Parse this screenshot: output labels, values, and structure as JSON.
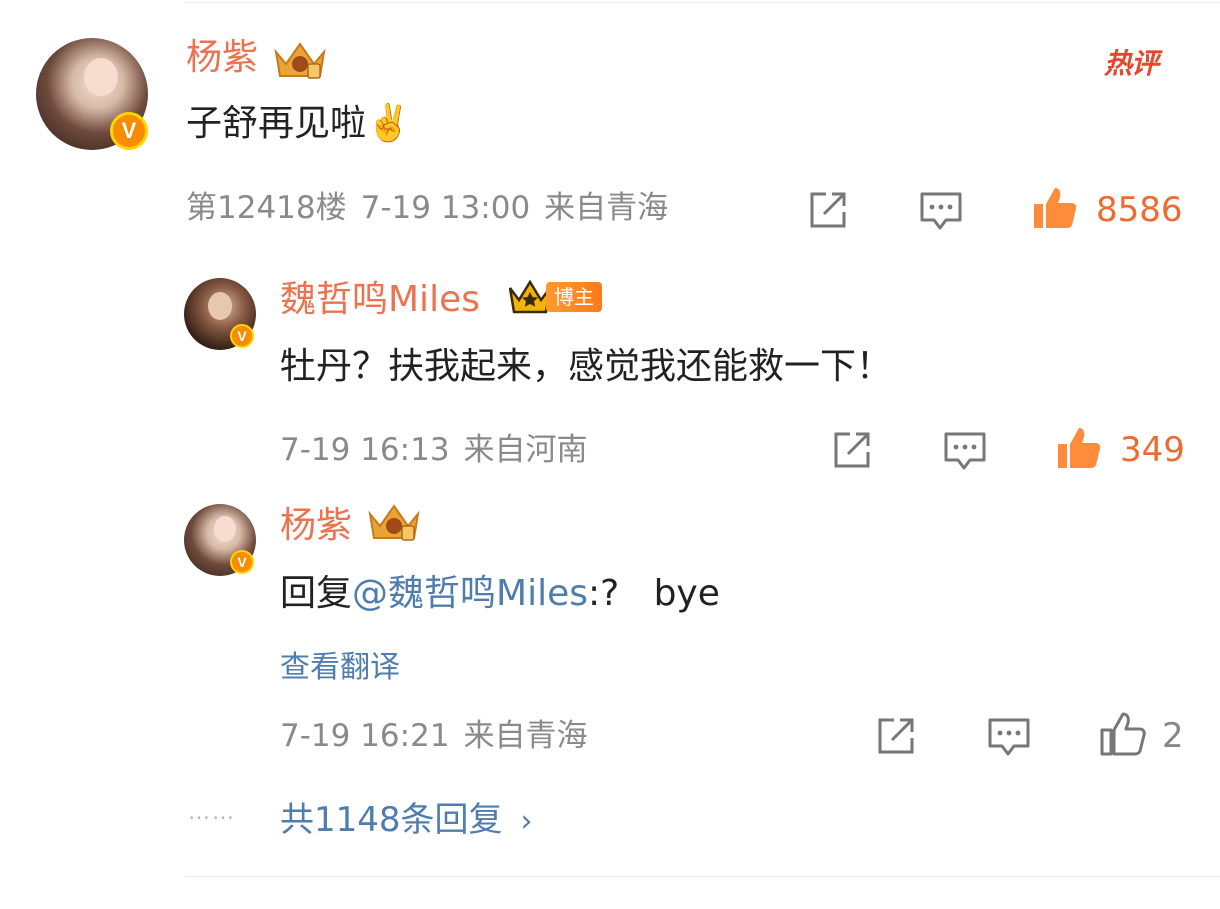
{
  "comment": {
    "author": "杨紫",
    "hot_label": "热评",
    "text": "子舒再见啦✌️",
    "floor": "第12418楼",
    "time": "7-19 13:00",
    "location": "来自青海",
    "likes": "8586"
  },
  "replies": [
    {
      "author": "魏哲鸣Miles",
      "author_tag": "博主",
      "text": "牡丹？扶我起来，感觉我还能救一下！",
      "time": "7-19 16:13",
      "location": "来自河南",
      "likes": "349"
    },
    {
      "author": "杨紫",
      "reply_prefix": "回复",
      "mention": "@魏哲鸣Miles",
      "text": ":?   bye",
      "translate_label": "查看翻译",
      "time": "7-19 16:21",
      "location": "来自青海",
      "likes": "2"
    }
  ],
  "more_replies": {
    "dots": "……",
    "label": "共1148条回复",
    "chevron": "›"
  },
  "colors": {
    "name": "#eb7350",
    "link": "#507daf",
    "like_active": "#ee6b2f",
    "meta": "#8a8a8a"
  },
  "icons": [
    "crown-icon",
    "verified-badge-icon",
    "share-icon",
    "comment-icon",
    "like-icon",
    "chevron-right-icon"
  ]
}
